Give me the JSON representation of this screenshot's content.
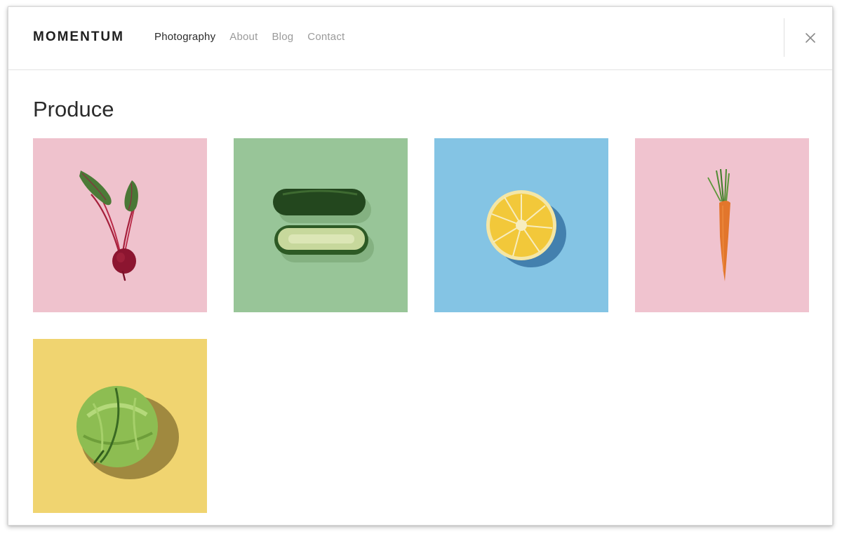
{
  "header": {
    "brand": "MOMENTUM",
    "nav": [
      {
        "label": "Photography",
        "active": true
      },
      {
        "label": "About",
        "active": false
      },
      {
        "label": "Blog",
        "active": false
      },
      {
        "label": "Contact",
        "active": false
      }
    ],
    "close_icon": "close-icon"
  },
  "main": {
    "title": "Produce",
    "gallery": [
      {
        "subject": "beet-icon",
        "background": "#efc2cd"
      },
      {
        "subject": "cucumber-icon",
        "background": "#98c598"
      },
      {
        "subject": "lemon-icon",
        "background": "#84c4e4"
      },
      {
        "subject": "carrot-icon",
        "background": "#f0c3cf"
      },
      {
        "subject": "cabbage-icon",
        "background": "#f0d470"
      }
    ]
  },
  "colors": {
    "text_primary": "#1f1f1f",
    "text_muted": "#9a9a9a",
    "border": "#e3e3e3"
  }
}
